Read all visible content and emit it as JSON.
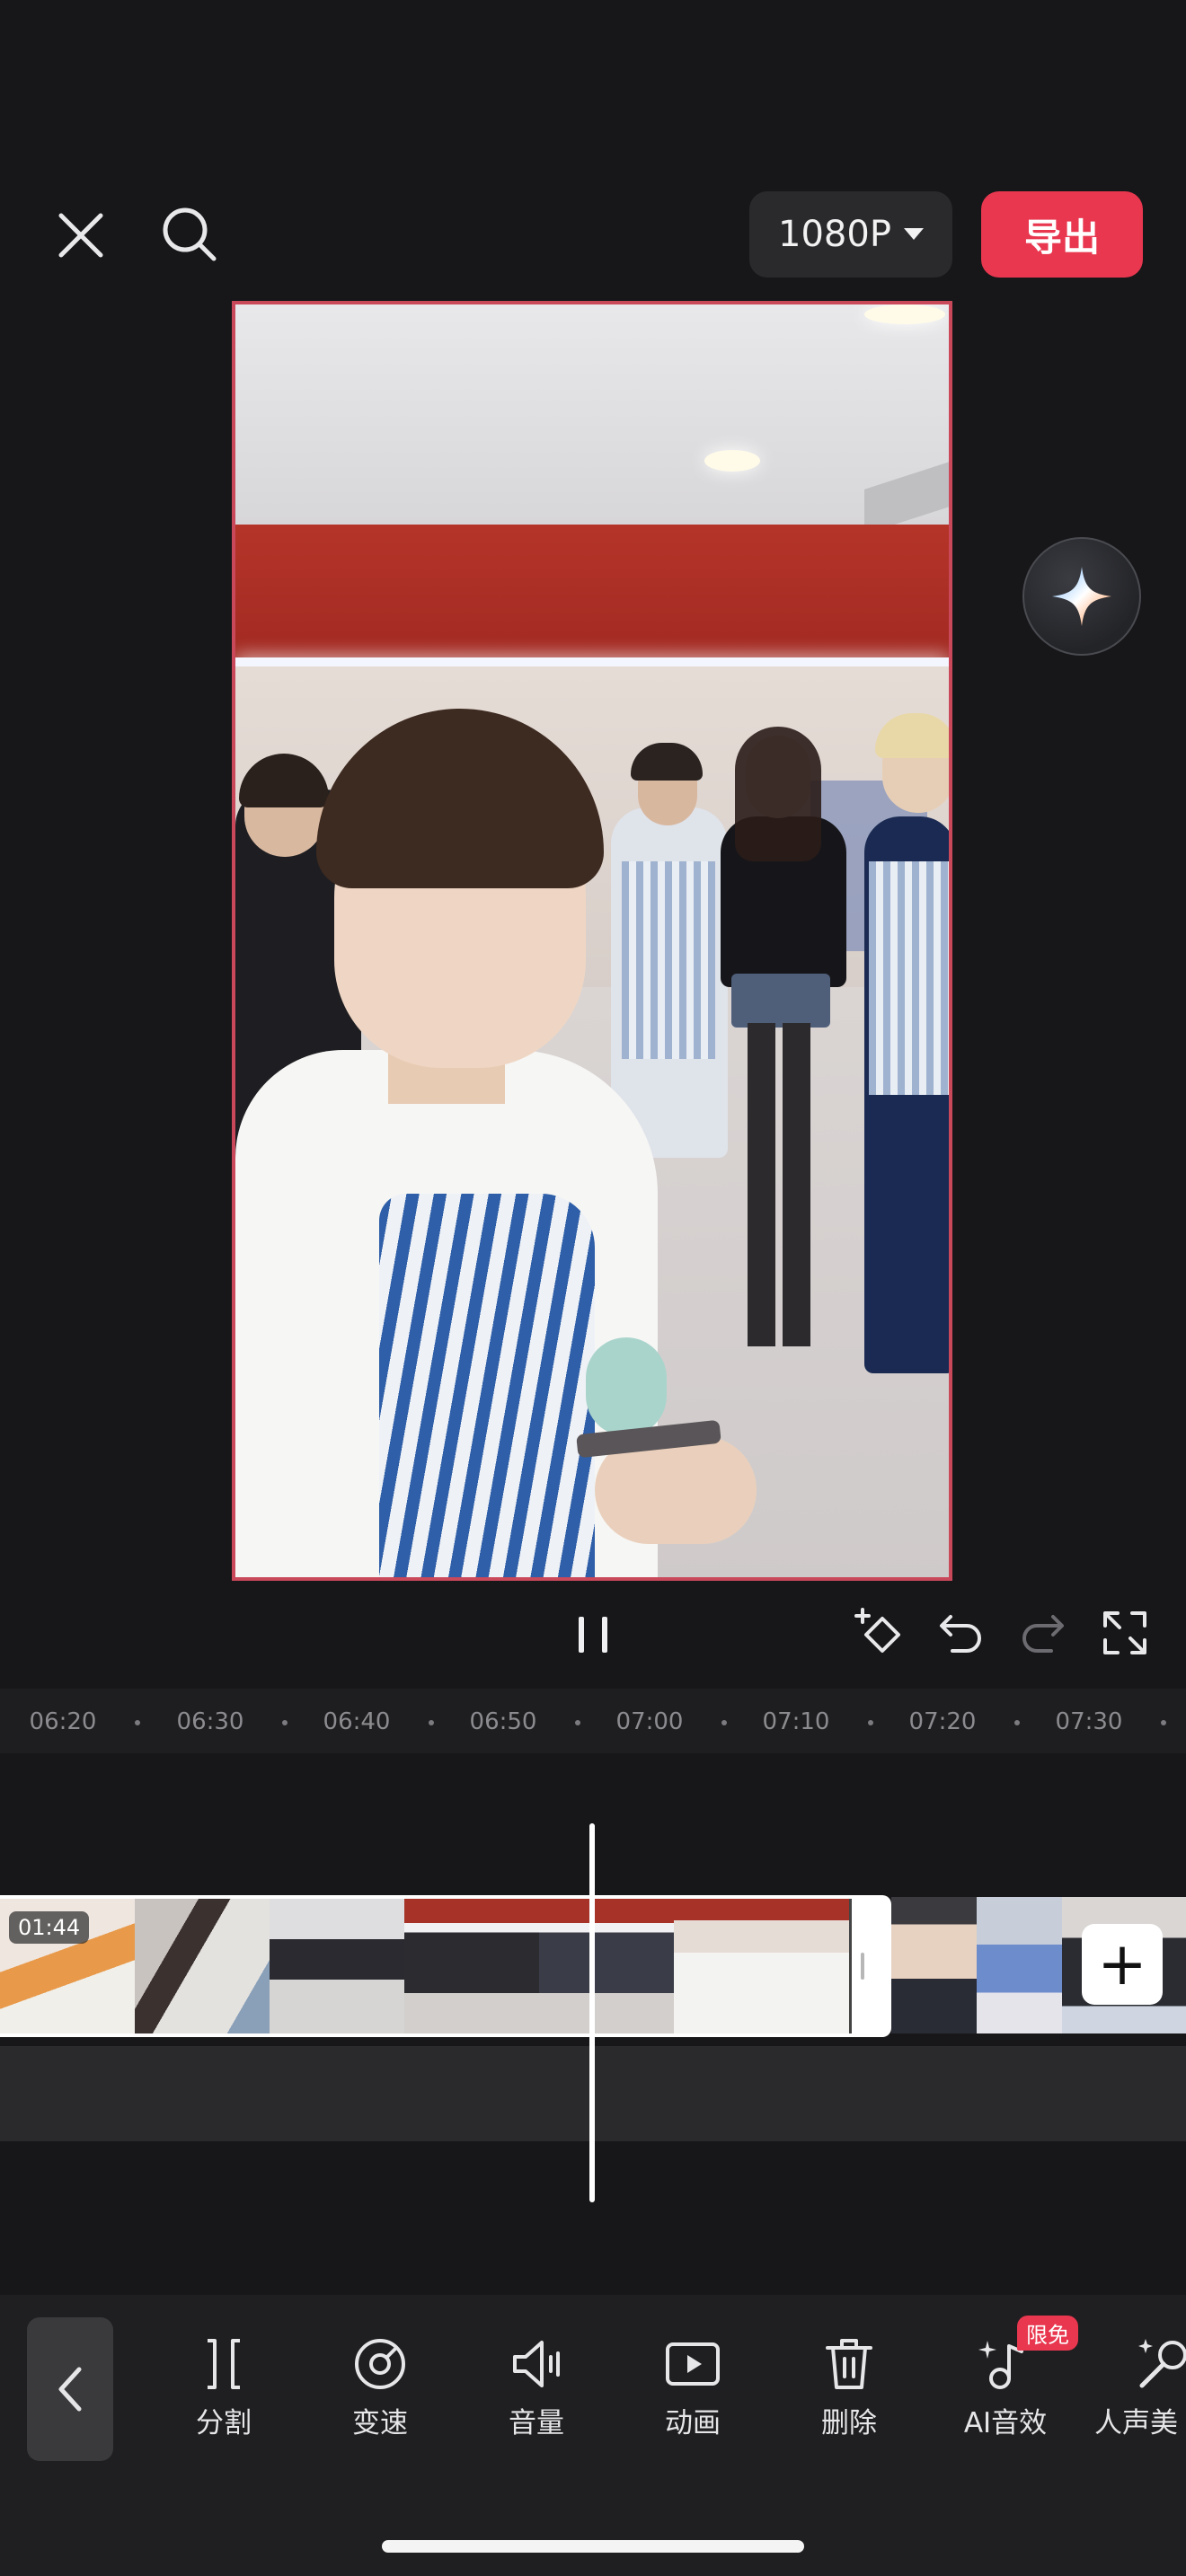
{
  "topbar": {
    "resolution_label": "1080P",
    "export_label": "导出"
  },
  "ruler": {
    "ticks": [
      "06:20",
      "06:30",
      "06:40",
      "06:50",
      "07:00",
      "07:10",
      "07:20",
      "07:30"
    ]
  },
  "timeline": {
    "clip_duration": "01:44",
    "add_label": "+"
  },
  "toolbar": {
    "tools": [
      {
        "label": "分割",
        "icon": "split-icon"
      },
      {
        "label": "变速",
        "icon": "speed-icon"
      },
      {
        "label": "音量",
        "icon": "volume-icon"
      },
      {
        "label": "动画",
        "icon": "animation-icon"
      },
      {
        "label": "删除",
        "icon": "trash-icon"
      },
      {
        "label": "AI音效",
        "icon": "ai-sound-icon"
      },
      {
        "label": "人声美",
        "icon": "voice-beauty-icon"
      }
    ],
    "promo_badge": "限免"
  },
  "colors": {
    "accent": "#e8374f",
    "background": "#171719"
  }
}
